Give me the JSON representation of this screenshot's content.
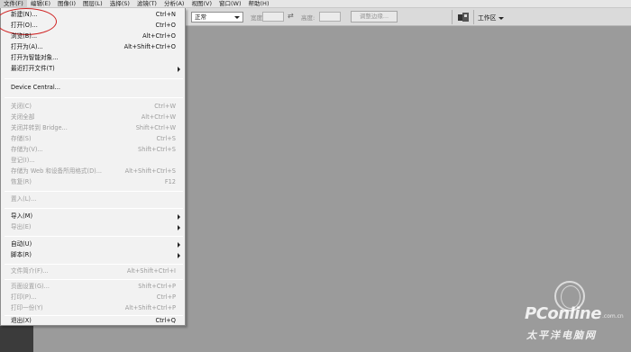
{
  "menubar": {
    "items": [
      "文件(F)",
      "编辑(E)",
      "图像(I)",
      "图层(L)",
      "选择(S)",
      "滤镜(T)",
      "分析(A)",
      "视图(V)",
      "窗口(W)",
      "帮助(H)"
    ]
  },
  "options_bar": {
    "mode_value": "正常",
    "width_label": "宽度:",
    "height_label": "高度:",
    "swap_icon": "⇄",
    "refine_button": "调整边缘...",
    "workspace_label": "工作区"
  },
  "file_menu": {
    "items": [
      {
        "label": "新建(N)...",
        "shortcut": "Ctrl+N",
        "enabled": true,
        "submenu": false
      },
      {
        "label": "打开(O)...",
        "shortcut": "Ctrl+O",
        "enabled": true,
        "submenu": false
      },
      {
        "label": "浏览(B)...",
        "shortcut": "Alt+Ctrl+O",
        "enabled": true,
        "submenu": false
      },
      {
        "label": "打开为(A)...",
        "shortcut": "Alt+Shift+Ctrl+O",
        "enabled": true,
        "submenu": false
      },
      {
        "label": "打开为智能对象...",
        "shortcut": "",
        "enabled": true,
        "submenu": false
      },
      {
        "label": "最近打开文件(T)",
        "shortcut": "",
        "enabled": true,
        "submenu": true
      },
      {
        "label": "Device Central...",
        "shortcut": "",
        "enabled": true,
        "submenu": false
      },
      {
        "label": "关闭(C)",
        "shortcut": "Ctrl+W",
        "enabled": false,
        "submenu": false
      },
      {
        "label": "关闭全部",
        "shortcut": "Alt+Ctrl+W",
        "enabled": false,
        "submenu": false
      },
      {
        "label": "关闭并转到 Bridge...",
        "shortcut": "Shift+Ctrl+W",
        "enabled": false,
        "submenu": false
      },
      {
        "label": "存储(S)",
        "shortcut": "Ctrl+S",
        "enabled": false,
        "submenu": false
      },
      {
        "label": "存储为(V)...",
        "shortcut": "Shift+Ctrl+S",
        "enabled": false,
        "submenu": false
      },
      {
        "label": "登记(I)...",
        "shortcut": "",
        "enabled": false,
        "submenu": false
      },
      {
        "label": "存储为 Web 和设备所用格式(D)...",
        "shortcut": "Alt+Shift+Ctrl+S",
        "enabled": false,
        "submenu": false
      },
      {
        "label": "恢复(R)",
        "shortcut": "F12",
        "enabled": false,
        "submenu": false
      },
      {
        "label": "置入(L)...",
        "shortcut": "",
        "enabled": false,
        "submenu": false
      },
      {
        "label": "导入(M)",
        "shortcut": "",
        "enabled": true,
        "submenu": true
      },
      {
        "label": "导出(E)",
        "shortcut": "",
        "enabled": false,
        "submenu": true
      },
      {
        "label": "自动(U)",
        "shortcut": "",
        "enabled": true,
        "submenu": true
      },
      {
        "label": "脚本(R)",
        "shortcut": "",
        "enabled": true,
        "submenu": true
      },
      {
        "label": "文件简介(F)...",
        "shortcut": "Alt+Shift+Ctrl+I",
        "enabled": false,
        "submenu": false
      },
      {
        "label": "页面设置(G)...",
        "shortcut": "Shift+Ctrl+P",
        "enabled": false,
        "submenu": false
      },
      {
        "label": "打印(P)...",
        "shortcut": "Ctrl+P",
        "enabled": false,
        "submenu": false
      },
      {
        "label": "打印一份(Y)",
        "shortcut": "Alt+Shift+Ctrl+P",
        "enabled": false,
        "submenu": false
      },
      {
        "label": "退出(X)",
        "shortcut": "Ctrl+Q",
        "enabled": true,
        "submenu": false
      }
    ]
  },
  "watermark": {
    "brand": "PConline",
    "domain": ".com.cn",
    "cn_name": "太平洋电脑网"
  },
  "colors": {
    "canvas_bg": "#9b9b9b",
    "menu_bg": "#f2f2f2",
    "disabled_text": "#9c9c9c",
    "highlight_ring": "#d02424"
  }
}
